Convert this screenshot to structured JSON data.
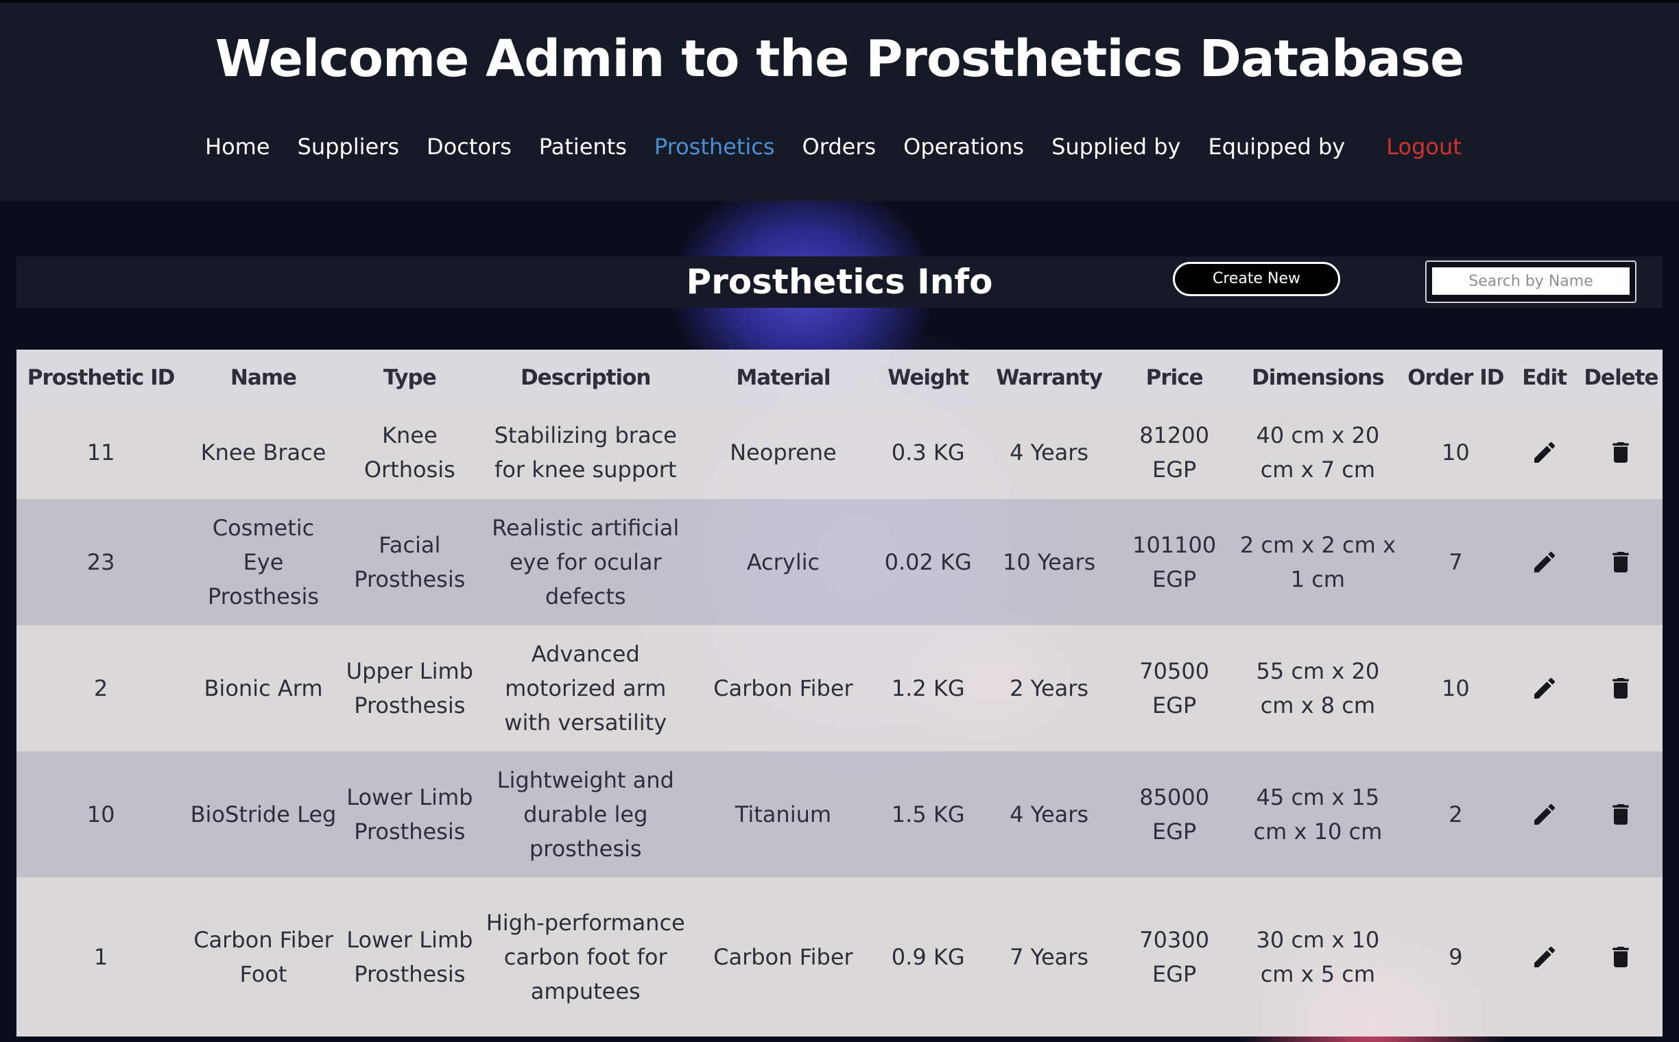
{
  "header": {
    "title": "Welcome Admin to the Prosthetics Database",
    "nav": [
      {
        "label": "Home"
      },
      {
        "label": "Suppliers"
      },
      {
        "label": "Doctors"
      },
      {
        "label": "Patients"
      },
      {
        "label": "Prosthetics",
        "active": true
      },
      {
        "label": "Orders"
      },
      {
        "label": "Operations"
      },
      {
        "label": "Supplied by"
      },
      {
        "label": "Equipped by"
      },
      {
        "label": "Logout"
      }
    ]
  },
  "info_bar": {
    "title": "Prosthetics Info",
    "create_label": "Create New",
    "search_placeholder": "Search by Name"
  },
  "table": {
    "columns": [
      "Prosthetic ID",
      "Name",
      "Type",
      "Description",
      "Material",
      "Weight",
      "Warranty",
      "Price",
      "Dimensions",
      "Order ID",
      "Edit",
      "Delete"
    ],
    "rows": [
      {
        "id": "11",
        "name": "Knee Brace",
        "type": "Knee Orthosis",
        "description": "Stabilizing brace for knee support",
        "material": "Neoprene",
        "weight": "0.3 KG",
        "warranty": "4 Years",
        "price": "81200 EGP",
        "dimensions": "40 cm x 20 cm x 7 cm",
        "order_id": "10"
      },
      {
        "id": "23",
        "name": "Cosmetic Eye Prosthesis",
        "type": "Facial Prosthesis",
        "description": "Realistic artificial eye for ocular defects",
        "material": "Acrylic",
        "weight": "0.02 KG",
        "warranty": "10 Years",
        "price": "101100 EGP",
        "dimensions": "2 cm x 2 cm x 1 cm",
        "order_id": "7"
      },
      {
        "id": "2",
        "name": "Bionic Arm",
        "type": "Upper Limb Prosthesis",
        "description": "Advanced motorized arm with versatility",
        "material": "Carbon Fiber",
        "weight": "1.2 KG",
        "warranty": "2 Years",
        "price": "70500 EGP",
        "dimensions": "55 cm x 20 cm x 8 cm",
        "order_id": "10"
      },
      {
        "id": "10",
        "name": "BioStride Leg",
        "type": "Lower Limb Prosthesis",
        "description": "Lightweight and durable leg prosthesis",
        "material": "Titanium",
        "weight": "1.5 KG",
        "warranty": "4 Years",
        "price": "85000 EGP",
        "dimensions": "45 cm x 15 cm x 10 cm",
        "order_id": "2"
      },
      {
        "id": "1",
        "name": "Carbon Fiber Foot",
        "type": "Lower Limb Prosthesis",
        "description": "High-performance carbon foot for amputees",
        "material": "Carbon Fiber",
        "weight": "0.9 KG",
        "warranty": "7 Years",
        "price": "70300 EGP",
        "dimensions": "30 cm x 10 cm x 5 cm",
        "order_id": "9"
      }
    ],
    "edit_icon": "pencil-icon",
    "delete_icon": "trash-icon"
  },
  "colors": {
    "header_bg": "#161a26",
    "active_nav": "#4a8fd6",
    "logout": "#d1332c"
  }
}
